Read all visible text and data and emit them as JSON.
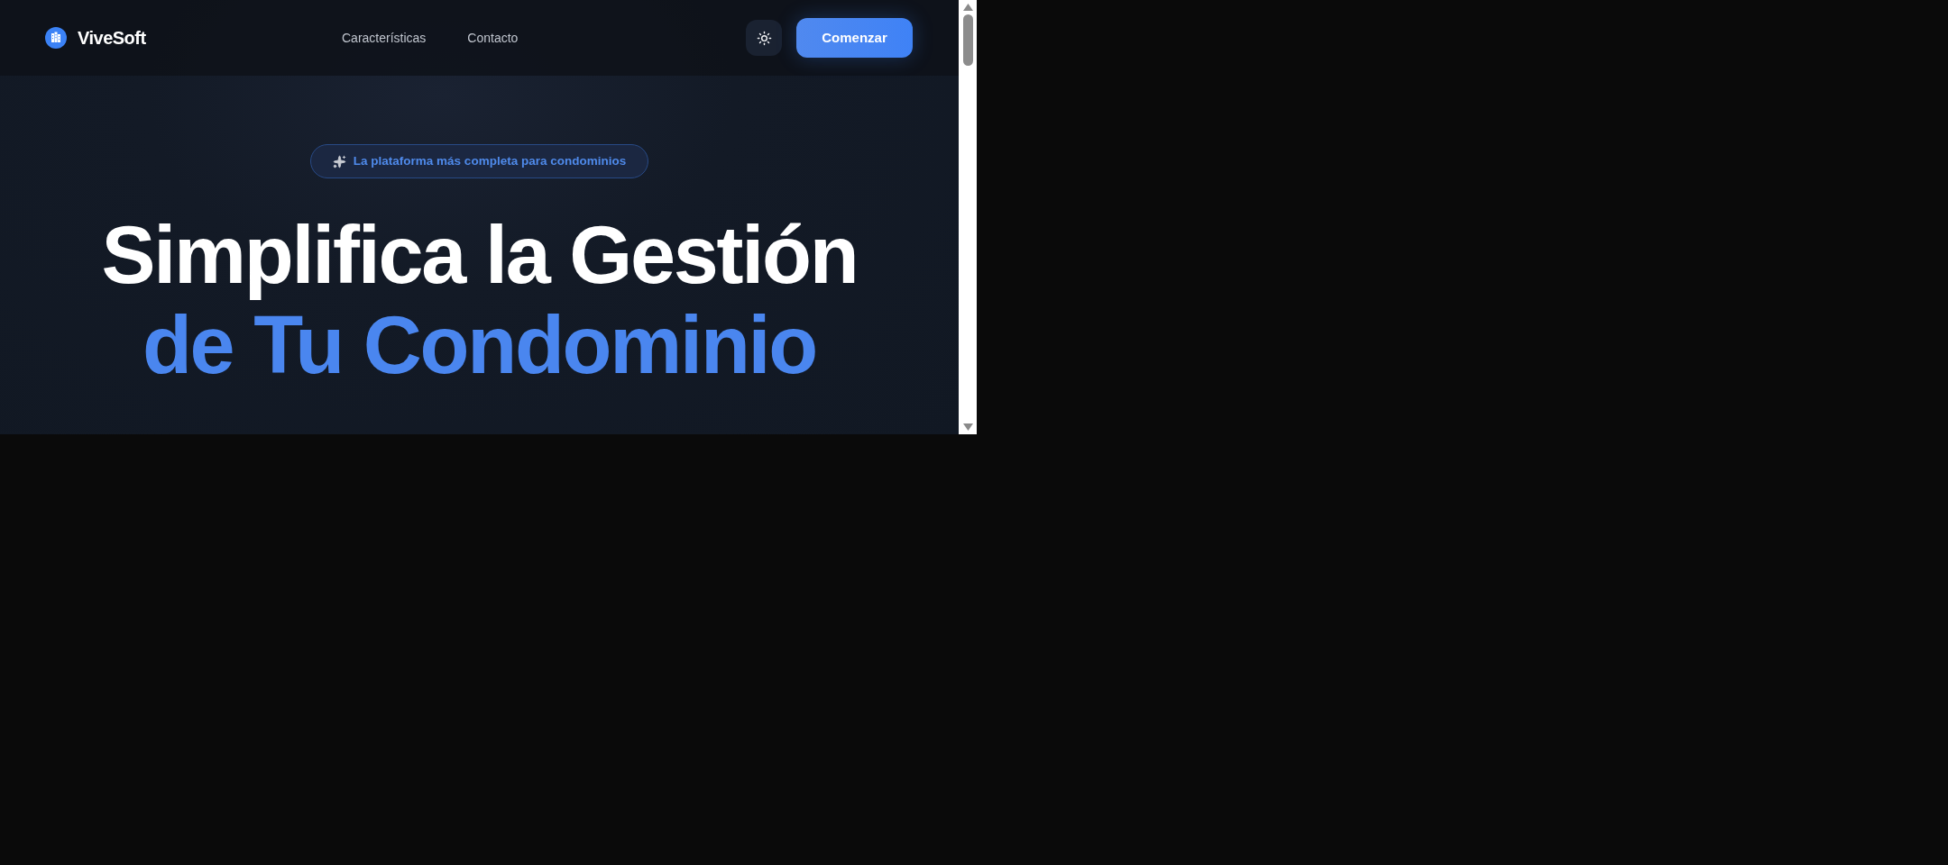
{
  "header": {
    "brand": "ViveSoft",
    "nav": [
      {
        "label": "Características"
      },
      {
        "label": "Contacto"
      }
    ],
    "cta": "Comenzar"
  },
  "hero": {
    "badge": "La plataforma más completa para condominios",
    "title_line_1": "Simplifica la Gestión",
    "title_line_2": "de Tu Condominio"
  }
}
